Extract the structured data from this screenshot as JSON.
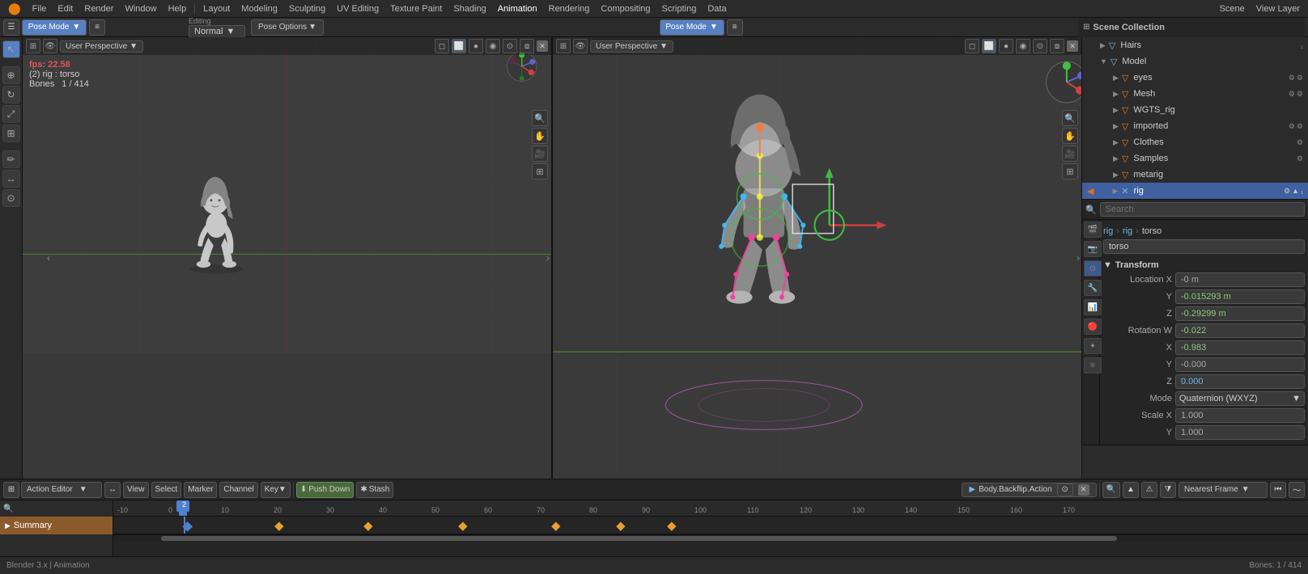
{
  "app": {
    "title": "Blender",
    "mode": "Animation"
  },
  "topMenu": {
    "items": [
      "🔵",
      "File",
      "Edit",
      "Render",
      "Window",
      "Help",
      "Layout",
      "Modeling",
      "Sculpting",
      "UV Editing",
      "Texture Paint",
      "Shading",
      "Animation",
      "Rendering",
      "Compositing",
      "Scripting",
      "Data"
    ]
  },
  "header": {
    "editingLabel": "Editing",
    "normalLabel": "Normal",
    "poseOptions": "Pose Options"
  },
  "leftViewport": {
    "mode": "Pose Mode",
    "fps": "fps: 22.58",
    "object": "(2) rig : torso",
    "bones": "Bones",
    "bonesCount": "1 / 414"
  },
  "rightViewport": {
    "mode": "Pose Mode"
  },
  "sceneCollection": {
    "title": "Scene Collection",
    "items": [
      {
        "label": "Hairs",
        "indent": 1,
        "icon": "▽",
        "expanded": false
      },
      {
        "label": "Model",
        "indent": 1,
        "icon": "▽",
        "expanded": true
      },
      {
        "label": "eyes",
        "indent": 2,
        "icon": "▽"
      },
      {
        "label": "Mesh",
        "indent": 2,
        "icon": "▽"
      },
      {
        "label": "WGTS_rig",
        "indent": 2,
        "icon": "▽"
      },
      {
        "label": "imported",
        "indent": 2,
        "icon": "▽"
      },
      {
        "label": "Clothes",
        "indent": 2,
        "icon": "▽"
      },
      {
        "label": "Samples",
        "indent": 2,
        "icon": "▽"
      },
      {
        "label": "metarig",
        "indent": 2,
        "icon": "▽"
      },
      {
        "label": "rig",
        "indent": 2,
        "icon": "▽",
        "highlighted": true
      }
    ]
  },
  "properties": {
    "searchPlaceholder": "Search",
    "breadcrumb": [
      "rig",
      "rig",
      "torso"
    ],
    "nameValue": "torso",
    "sections": {
      "transform": {
        "title": "Transform",
        "locationX": "-0 m",
        "locationY": "-0.015293 m",
        "locationZ": "-0.29299 m",
        "rotationW": "-0.022",
        "rotationX": "-0.983",
        "rotationY": "-0.000",
        "rotationZ": "0.000",
        "modeLabel": "Mode",
        "modeValue": "Quaternion (WXYZ)",
        "scaleX": "1.000",
        "scaleY": "1.000"
      }
    }
  },
  "timeline": {
    "editorLabel": "Action Editor",
    "viewLabel": "View",
    "selectLabel": "Select",
    "markerLabel": "Marker",
    "channelLabel": "Channel",
    "keyLabel": "Key",
    "pushDownLabel": "Push Down",
    "stashLabel": "Stash",
    "actionName": "Body.Backflip.Action",
    "nearestFrame": "Nearest Frame",
    "summaryLabel": "Summary",
    "currentFrame": "2",
    "frameMarks": [
      "-10",
      "0",
      "10",
      "20",
      "30",
      "40",
      "50",
      "60",
      "70",
      "80",
      "90",
      "100",
      "110",
      "120",
      "130",
      "140",
      "150",
      "160",
      "170"
    ]
  }
}
